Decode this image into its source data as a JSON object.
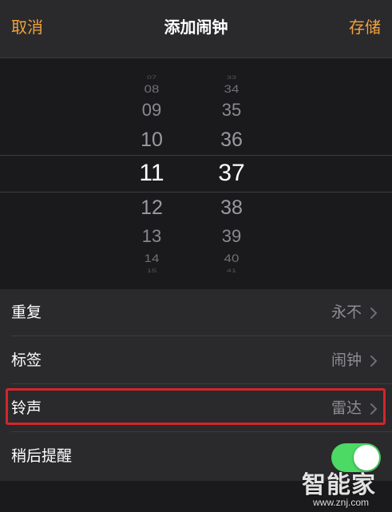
{
  "navbar": {
    "cancel_label": "取消",
    "title": "添加闹钟",
    "save_label": "存储"
  },
  "picker": {
    "hours": [
      "07",
      "08",
      "09",
      "10",
      "11",
      "12",
      "13",
      "14",
      "15"
    ],
    "minutes": [
      "33",
      "34",
      "35",
      "36",
      "37",
      "38",
      "39",
      "40",
      "41"
    ],
    "selected_hour": "11",
    "selected_minute": "37"
  },
  "settings": {
    "repeat": {
      "label": "重复",
      "value": "永不"
    },
    "label": {
      "label": "标签",
      "value": "闹钟"
    },
    "sound": {
      "label": "铃声",
      "value": "雷达"
    },
    "snooze": {
      "label": "稍后提醒",
      "enabled": true
    }
  },
  "watermark": {
    "brand": "智能家",
    "url": "www.znj.com"
  },
  "colors": {
    "accent": "#f0a23b",
    "toggle_on": "#4cd964",
    "highlight": "#d3262b"
  }
}
